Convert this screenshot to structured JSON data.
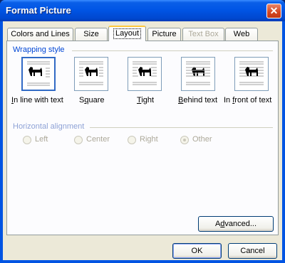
{
  "window": {
    "title": "Format Picture",
    "close_glyph": "✕"
  },
  "tabs": [
    {
      "label": "Colors and Lines",
      "state": "normal"
    },
    {
      "label": "Size",
      "state": "normal"
    },
    {
      "label": "Layout",
      "state": "active"
    },
    {
      "label": "Picture",
      "state": "normal"
    },
    {
      "label": "Text Box",
      "state": "disabled"
    },
    {
      "label": "Web",
      "state": "normal"
    }
  ],
  "wrapping": {
    "title": "Wrapping style",
    "options": [
      {
        "label": "In line with text",
        "mnemonic": "I",
        "rest": "n line with text",
        "icon": "dog-inline-icon",
        "selected": true
      },
      {
        "label": "Square",
        "mnemonic": "q",
        "pre": "S",
        "rest": "uare",
        "icon": "dog-square-icon",
        "selected": false
      },
      {
        "label": "Tight",
        "mnemonic": "T",
        "rest": "ight",
        "icon": "dog-tight-icon",
        "selected": false
      },
      {
        "label": "Behind text",
        "mnemonic": "B",
        "rest": "ehind text",
        "icon": "dog-behind-icon",
        "selected": false
      },
      {
        "label": "In front of text",
        "mnemonic": "f",
        "pre": "In ",
        "rest": "ront of text",
        "icon": "dog-front-icon",
        "selected": false
      }
    ]
  },
  "alignment": {
    "title": "Horizontal alignment",
    "options": [
      {
        "label": "Left",
        "checked": false,
        "enabled": false
      },
      {
        "label": "Center",
        "checked": false,
        "enabled": false
      },
      {
        "label": "Right",
        "checked": false,
        "enabled": false
      },
      {
        "label": "Other",
        "checked": true,
        "enabled": false
      }
    ]
  },
  "buttons": {
    "advanced": "Advanced...",
    "advanced_mnemonic": "d",
    "ok": "OK",
    "cancel": "Cancel"
  },
  "colors": {
    "accent": "#0046d5",
    "titlebar": "#0055e5",
    "face": "#ece9d8"
  }
}
